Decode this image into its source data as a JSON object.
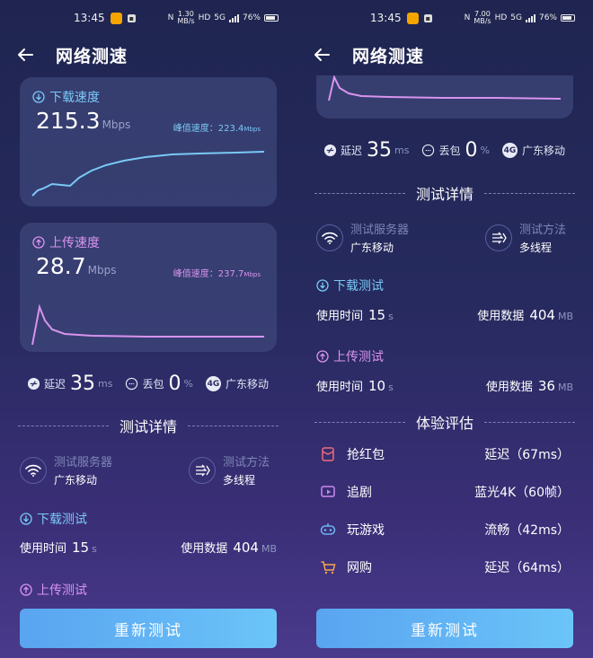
{
  "colors": {
    "download": "#79c9f6",
    "upload": "#d894ee",
    "accent": "#63b7f5"
  },
  "left": {
    "status": {
      "time": "13:45",
      "hd": "HD",
      "net_speed_top": "1.30",
      "net_speed_bottom": "MB/s",
      "signal": "5G",
      "battery": "76%"
    },
    "header": {
      "title": "网络测速"
    },
    "download": {
      "label": "下载速度",
      "value": "215.3",
      "unit": "Mbps",
      "peak_label": "峰值速度：223.4",
      "peak_unit": "Mbps"
    },
    "upload": {
      "label": "上传速度",
      "value": "28.7",
      "unit": "Mbps",
      "peak_label": "峰值速度：237.7",
      "peak_unit": "Mbps"
    },
    "metrics": {
      "latency_label": "延迟",
      "latency_value": "35",
      "latency_unit": "ms",
      "loss_label": "丢包",
      "loss_value": "0",
      "loss_unit": "%",
      "network_badge": "4G",
      "network_name": "广东移动"
    },
    "details_title": "测试详情",
    "server": {
      "label": "测试服务器",
      "value": "广东移动"
    },
    "method": {
      "label": "测试方法",
      "value": "多线程"
    },
    "download_test": {
      "title": "下载测试",
      "time_label": "使用时间",
      "time_value": "15",
      "time_unit": "s",
      "data_label": "使用数据",
      "data_value": "404",
      "data_unit": "MB"
    },
    "upload_test": {
      "title": "上传测试"
    },
    "retest_label": "重新测试"
  },
  "right": {
    "status": {
      "time": "13:45",
      "hd": "HD",
      "net_speed_top": "7.00",
      "net_speed_bottom": "MB/s",
      "signal": "5G",
      "battery": "76%"
    },
    "header": {
      "title": "网络测速"
    },
    "metrics": {
      "latency_label": "延迟",
      "latency_value": "35",
      "latency_unit": "ms",
      "loss_label": "丢包",
      "loss_value": "0",
      "loss_unit": "%",
      "network_badge": "4G",
      "network_name": "广东移动"
    },
    "details_title": "测试详情",
    "server": {
      "label": "测试服务器",
      "value": "广东移动"
    },
    "method": {
      "label": "测试方法",
      "value": "多线程"
    },
    "download_test": {
      "title": "下载测试",
      "time_label": "使用时间",
      "time_value": "15",
      "time_unit": "s",
      "data_label": "使用数据",
      "data_value": "404",
      "data_unit": "MB"
    },
    "upload_test": {
      "title": "上传测试",
      "time_label": "使用时间",
      "time_value": "10",
      "time_unit": "s",
      "data_label": "使用数据",
      "data_value": "36",
      "data_unit": "MB"
    },
    "evaluation_title": "体验评估",
    "evaluations": [
      {
        "icon": "red-envelope-icon",
        "label": "抢红包",
        "result": "延迟（67ms）"
      },
      {
        "icon": "tv-play-icon",
        "label": "追剧",
        "result": "蓝光4K（60帧）"
      },
      {
        "icon": "gamepad-icon",
        "label": "玩游戏",
        "result": "流畅（42ms）"
      },
      {
        "icon": "shopping-cart-icon",
        "label": "网购",
        "result": "延迟（64ms）"
      }
    ],
    "retest_label": "重新测试"
  }
}
